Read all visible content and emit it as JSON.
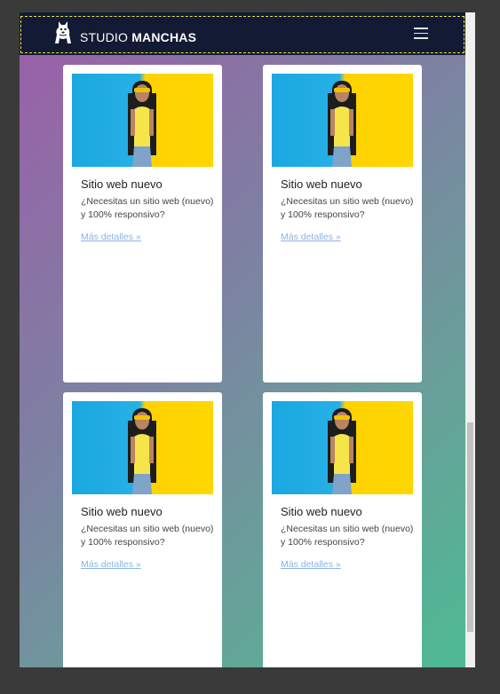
{
  "brand": {
    "name_light": "STUDIO",
    "name_bold": "MANCHAS",
    "logo_icon": "dog-logo-icon"
  },
  "navbar": {
    "menu_icon": "hamburger-menu-icon",
    "background": "#131a33"
  },
  "cards": [
    {
      "title": "Sitio web nuevo",
      "description": "¿Necesitas un sitio web (nuevo) y 100% responsivo?",
      "link_label": "Más detalles",
      "link_icon": "double-chevron-right-icon"
    },
    {
      "title": "Sitio web nuevo",
      "description": "¿Necesitas un sitio web (nuevo) y 100% responsivo?",
      "link_label": "Más detalles",
      "link_icon": "double-chevron-right-icon"
    },
    {
      "title": "Sitio web nuevo",
      "description": "¿Necesitas un sitio web (nuevo) y 100% responsivo?",
      "link_label": "Más detalles",
      "link_icon": "double-chevron-right-icon"
    },
    {
      "title": "Sitio web nuevo",
      "description": "¿Necesitas un sitio web (nuevo) y 100% responsivo?",
      "link_label": "Más detalles",
      "link_icon": "double-chevron-right-icon"
    }
  ],
  "colors": {
    "link": "#8bb3e3",
    "accent_yellow": "#ffd200",
    "accent_blue": "#1aa8e0"
  }
}
